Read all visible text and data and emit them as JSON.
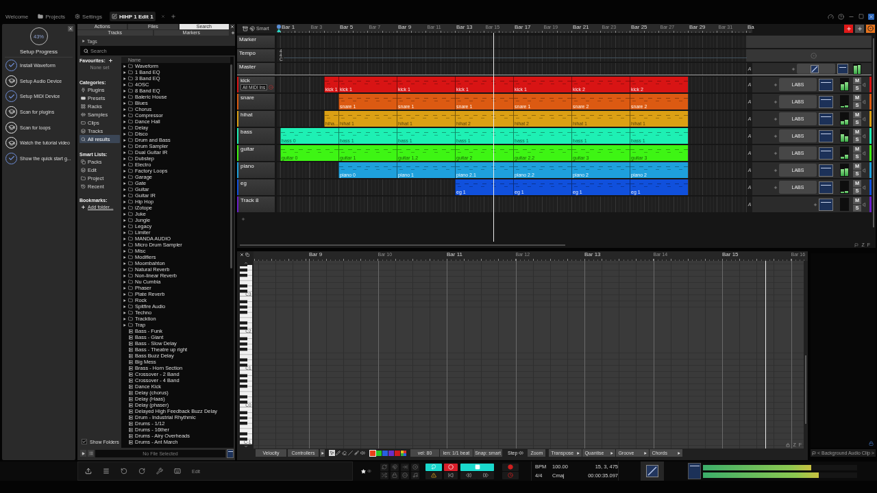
{
  "top_tabs": [
    {
      "label": "Welcome",
      "kind": "text",
      "selected": false
    },
    {
      "label": "Projects",
      "kind": "folder",
      "selected": false
    },
    {
      "label": "Settings",
      "kind": "gear",
      "selected": false
    },
    {
      "label": "HIHP 1 Edit 1",
      "kind": "edit",
      "selected": true
    }
  ],
  "setup": {
    "progress": "43%",
    "title": "Setup Progress",
    "items": [
      {
        "label": "Install Waveform",
        "kind": "done"
      },
      {
        "label": "Setup Audio Device",
        "kind": "todo"
      },
      {
        "label": "Setup MIDI Device",
        "kind": "done"
      },
      {
        "label": "Scan for plugins",
        "kind": "todo"
      },
      {
        "label": "Scan for loops",
        "kind": "todo"
      },
      {
        "label": "Watch the tutorial video",
        "kind": "todo"
      },
      {
        "label": "Show the quick start g...",
        "kind": "done"
      }
    ]
  },
  "browser": {
    "tabs": [
      [
        {
          "label": "Actions",
          "selected": false
        },
        {
          "label": "Files",
          "selected": false
        },
        {
          "label": "Search",
          "selected": true
        }
      ],
      [
        {
          "label": "Tracks",
          "selected": false
        },
        {
          "label": "Markers",
          "selected": false
        }
      ]
    ],
    "tags": "Tags",
    "search": {
      "placeholder": "Search"
    },
    "favourites": {
      "heading": "Favourites:",
      "empty": "None set"
    },
    "categories": {
      "heading": "Categories:",
      "items": [
        {
          "label": "Plugins",
          "kind": "plug",
          "selected": false
        },
        {
          "label": "Presets",
          "kind": "preset",
          "selected": false
        },
        {
          "label": "Racks",
          "kind": "rack",
          "selected": false
        },
        {
          "label": "Samples",
          "kind": "sample",
          "selected": false
        },
        {
          "label": "Clips",
          "kind": "clip",
          "selected": false
        },
        {
          "label": "Tracks",
          "kind": "track",
          "selected": false
        },
        {
          "label": "All results",
          "kind": "search",
          "selected": true
        }
      ]
    },
    "smart_lists": {
      "heading": "Smart Lists:",
      "items": [
        {
          "label": "Packs",
          "kind": "pack",
          "selected": false
        },
        {
          "label": "Edit",
          "kind": "edit",
          "selected": false
        },
        {
          "label": "Project",
          "kind": "folder",
          "selected": false
        },
        {
          "label": "Recent",
          "kind": "recent",
          "selected": false
        }
      ]
    },
    "bookmarks": {
      "heading": "Bookmarks:",
      "link": "Add folder..."
    },
    "show_folders": {
      "label": "Show Folders",
      "checked": true
    },
    "column": "Name",
    "files": [
      {
        "name": "Waveform",
        "kind": "folder"
      },
      {
        "name": "1 Band EQ",
        "kind": "folder"
      },
      {
        "name": "3 Band EQ",
        "kind": "folder"
      },
      {
        "name": "4OSC",
        "kind": "folder"
      },
      {
        "name": "8 Band EQ",
        "kind": "folder"
      },
      {
        "name": "Baleric House",
        "kind": "folder"
      },
      {
        "name": "Blues",
        "kind": "folder"
      },
      {
        "name": "Chorus",
        "kind": "folder"
      },
      {
        "name": "Compressor",
        "kind": "folder"
      },
      {
        "name": "Dance Hall",
        "kind": "folder"
      },
      {
        "name": "Delay",
        "kind": "folder"
      },
      {
        "name": "Disco",
        "kind": "folder"
      },
      {
        "name": "Drum and Bass",
        "kind": "folder"
      },
      {
        "name": "Drum Sampler",
        "kind": "folder"
      },
      {
        "name": "Dual Guitar IR",
        "kind": "folder"
      },
      {
        "name": "Dubstep",
        "kind": "folder"
      },
      {
        "name": "Electro",
        "kind": "folder"
      },
      {
        "name": "Factory Loops",
        "kind": "folder"
      },
      {
        "name": "Garage",
        "kind": "folder"
      },
      {
        "name": "Gate",
        "kind": "folder"
      },
      {
        "name": "Guitar",
        "kind": "folder"
      },
      {
        "name": "Guitar IR",
        "kind": "folder"
      },
      {
        "name": "Hip Hop",
        "kind": "folder"
      },
      {
        "name": "iZotope",
        "kind": "folder"
      },
      {
        "name": "Juke",
        "kind": "folder"
      },
      {
        "name": "Jungle",
        "kind": "folder"
      },
      {
        "name": "Legacy",
        "kind": "folder"
      },
      {
        "name": "Limiter",
        "kind": "folder"
      },
      {
        "name": "MANDA AUDIO",
        "kind": "folder"
      },
      {
        "name": "Micro Drum Sampler",
        "kind": "folder"
      },
      {
        "name": "Misc",
        "kind": "folder"
      },
      {
        "name": "Modifiers",
        "kind": "folder"
      },
      {
        "name": "Moombahton",
        "kind": "folder"
      },
      {
        "name": "Natural Reverb",
        "kind": "folder"
      },
      {
        "name": "Non-linear Reverb",
        "kind": "folder"
      },
      {
        "name": "Nu Cumbia",
        "kind": "folder"
      },
      {
        "name": "Phaser",
        "kind": "folder"
      },
      {
        "name": "Plate Reverb",
        "kind": "folder"
      },
      {
        "name": "Rock",
        "kind": "folder"
      },
      {
        "name": "Spitfire Audio",
        "kind": "folder"
      },
      {
        "name": "Techno",
        "kind": "folder"
      },
      {
        "name": "Tracktion",
        "kind": "folder"
      },
      {
        "name": "Trap",
        "kind": "folder"
      },
      {
        "name": "Bass - Funk",
        "kind": "preset"
      },
      {
        "name": "Bass - Giant",
        "kind": "preset"
      },
      {
        "name": "Bass - Slow Delay",
        "kind": "preset"
      },
      {
        "name": "Bass - Theatre up right",
        "kind": "preset"
      },
      {
        "name": "Bass Buzz Delay",
        "kind": "preset"
      },
      {
        "name": "Big Mess",
        "kind": "preset"
      },
      {
        "name": "Brass - Horn Section",
        "kind": "preset"
      },
      {
        "name": "Crossover - 2 Band",
        "kind": "preset"
      },
      {
        "name": "Crossover - 4 Band",
        "kind": "preset"
      },
      {
        "name": "Dance Kick",
        "kind": "preset"
      },
      {
        "name": "Delay (chorus)",
        "kind": "preset"
      },
      {
        "name": "Delay (Haas)",
        "kind": "preset"
      },
      {
        "name": "Delay (phaser)",
        "kind": "preset"
      },
      {
        "name": "Delayed High Feedback Buzz Delay",
        "kind": "preset"
      },
      {
        "name": "Drum - Industrial Rhythmic",
        "kind": "preset"
      },
      {
        "name": "Drums - 1/12",
        "kind": "preset"
      },
      {
        "name": "Drums - 16ther",
        "kind": "preset"
      },
      {
        "name": "Drums - Airy Overheads",
        "kind": "preset"
      },
      {
        "name": "Drums - Ant March",
        "kind": "preset"
      }
    ],
    "status": "No File Selected"
  },
  "arranger": {
    "mode": "Smart",
    "ruler": [
      {
        "label": "Bar 1",
        "major": true
      },
      {
        "label": "Bar 3",
        "major": false
      },
      {
        "label": "Bar 5",
        "major": true
      },
      {
        "label": "Bar 7",
        "major": false
      },
      {
        "label": "Bar 9",
        "major": true
      },
      {
        "label": "Bar 11",
        "major": false
      },
      {
        "label": "Bar 13",
        "major": true
      },
      {
        "label": "Bar 15",
        "major": false
      },
      {
        "label": "Bar 17",
        "major": true
      },
      {
        "label": "Bar 19",
        "major": false
      },
      {
        "label": "Bar 21",
        "major": true
      },
      {
        "label": "Bar 23",
        "major": false
      },
      {
        "label": "Bar 25",
        "major": true
      },
      {
        "label": "Bar 27",
        "major": false
      },
      {
        "label": "Bar 29",
        "major": true
      },
      {
        "label": "Bar 31",
        "major": false
      },
      {
        "label": "Ba",
        "major": true
      }
    ],
    "tracks": [
      {
        "name": "Marker",
        "kind": "marker"
      },
      {
        "name": "Tempo",
        "kind": "tempo",
        "signature": [
          "4",
          "4",
          "C"
        ]
      },
      {
        "name": "Master",
        "kind": "master",
        "automation": "A",
        "meter": [
          {
            "level": 0.8
          },
          {
            "level": 0.9
          }
        ]
      },
      {
        "name": "kick",
        "kind": "instrument",
        "color": "#d81414",
        "input": "All MIDI Ins",
        "automation": "A",
        "plugin": "LABS",
        "mute": "M",
        "solo": "S",
        "meter": [
          {
            "level": 0.55
          },
          {
            "level": 0.7
          }
        ],
        "clips": [
          {
            "label": "kick 1",
            "kind": "short"
          },
          {
            "label": "kick 1",
            "kind": "long"
          },
          {
            "label": "kick 1",
            "kind": "long"
          },
          {
            "label": "kick 1",
            "kind": "long"
          },
          {
            "label": "kick 1",
            "kind": "long"
          },
          {
            "label": "kick 2",
            "kind": "long"
          },
          {
            "label": "kick 2",
            "kind": "long"
          }
        ]
      },
      {
        "name": "snare",
        "kind": "instrument",
        "color": "#dc5a12",
        "automation": "A",
        "plugin": "LABS",
        "mute": "M",
        "solo": "S",
        "meter": [
          {
            "level": 0.12
          },
          {
            "level": 0.18
          }
        ],
        "clips": [
          {
            "label": "snare 1",
            "kind": "long"
          },
          {
            "label": "snare 1",
            "kind": "long"
          },
          {
            "label": "snare 1",
            "kind": "long"
          },
          {
            "label": "snare 1",
            "kind": "long"
          },
          {
            "label": "snare 2",
            "kind": "long"
          },
          {
            "label": "snare 2",
            "kind": "long"
          }
        ]
      },
      {
        "name": "hihat",
        "kind": "instrument",
        "color": "#dca014",
        "automation": "A",
        "plugin": "LABS",
        "mute": "M",
        "solo": "S",
        "meter": [
          {
            "level": 0.3
          },
          {
            "level": 0.4
          }
        ],
        "clips": [
          {
            "label": "hiha...",
            "kind": "short"
          },
          {
            "label": "hihat 1",
            "kind": "long"
          },
          {
            "label": "hihat 1",
            "kind": "long"
          },
          {
            "label": "hihat 2",
            "kind": "long"
          },
          {
            "label": "hihat 2",
            "kind": "long"
          },
          {
            "label": "hihat 1",
            "kind": "long"
          },
          {
            "label": "hihat 1",
            "kind": "long"
          }
        ]
      },
      {
        "name": "bass",
        "kind": "instrument",
        "color": "#1ef0b4",
        "automation": "A",
        "plugin": "LABS",
        "mute": "M",
        "solo": "S",
        "meter": [
          {
            "level": 0.65
          },
          {
            "level": 0.5
          }
        ],
        "clips": [
          {
            "label": "bass 0",
            "kind": "long"
          },
          {
            "label": "bass 1",
            "kind": "long"
          },
          {
            "label": "bass 1",
            "kind": "long"
          },
          {
            "label": "bass 1",
            "kind": "long"
          },
          {
            "label": "bass 1",
            "kind": "long"
          },
          {
            "label": "bass 1",
            "kind": "long"
          },
          {
            "label": "bass 1",
            "kind": "long"
          }
        ]
      },
      {
        "name": "guitar",
        "kind": "instrument",
        "color": "#3ef514",
        "automation": "A",
        "plugin": "LABS",
        "mute": "M",
        "solo": "S",
        "meter": [
          {
            "level": 0.15
          },
          {
            "level": 0.35
          }
        ],
        "clips": [
          {
            "label": "guitar 0",
            "kind": "long"
          },
          {
            "label": "guitar 1",
            "kind": "long"
          },
          {
            "label": "guitar 1.2",
            "kind": "long"
          },
          {
            "label": "guitar 2",
            "kind": "long"
          },
          {
            "label": "guitar 2.2",
            "kind": "long"
          },
          {
            "label": "guitar 3",
            "kind": "long"
          },
          {
            "label": "guitar 3",
            "kind": "long"
          }
        ]
      },
      {
        "name": "piano",
        "kind": "instrument",
        "color": "#1ea0dc",
        "automation": "A",
        "plugin": "LABS",
        "mute": "M",
        "solo": "S",
        "meter": [
          {
            "level": 0.6
          },
          {
            "level": 0.65
          }
        ],
        "clips": [
          {
            "label": "piano 0",
            "kind": "long"
          },
          {
            "label": "piano 1",
            "kind": "long"
          },
          {
            "label": "piano 2.1",
            "kind": "long"
          },
          {
            "label": "piano 2.2",
            "kind": "long"
          },
          {
            "label": "piano 2",
            "kind": "long"
          },
          {
            "label": "piano 2",
            "kind": "long"
          }
        ]
      },
      {
        "name": "eg",
        "kind": "instrument",
        "color": "#1050dc",
        "automation": "A",
        "plugin": "LABS",
        "mute": "M",
        "solo": "S",
        "meter": [
          {
            "level": 0.1
          },
          {
            "level": 0.15
          }
        ],
        "clips": [
          {
            "label": "eg 1",
            "kind": "long"
          },
          {
            "label": "eg 1",
            "kind": "long"
          },
          {
            "label": "eg 1",
            "kind": "long"
          },
          {
            "label": "eg 1",
            "kind": "long"
          }
        ]
      },
      {
        "name": "Track 8",
        "kind": "instrument",
        "color": "#6a1fc8",
        "automation": "A",
        "mute": "M",
        "solo": "S"
      }
    ],
    "footer": [
      "Z",
      "F"
    ]
  },
  "piano_roll": {
    "ruler": [
      {
        "label": "Bar 9",
        "major": true
      },
      {
        "label": "Bar 10",
        "major": false
      },
      {
        "label": "Bar 11",
        "major": true
      },
      {
        "label": "Bar 12",
        "major": false
      },
      {
        "label": "Bar 13",
        "major": true
      },
      {
        "label": "Bar 14",
        "major": false
      },
      {
        "label": "Bar 15",
        "major": true
      },
      {
        "label": "Bar 16",
        "major": false
      }
    ],
    "keys": [
      "C3",
      "C2",
      "C1",
      "C0",
      "C-1"
    ],
    "footer": [
      "Z",
      "F"
    ],
    "toolbar": {
      "views": [
        "Velocity",
        "Controllers"
      ],
      "tools": [
        {
          "kind": "pointer",
          "selected": true
        },
        {
          "kind": "pencil",
          "selected": false
        },
        {
          "kind": "eraser",
          "selected": false
        },
        {
          "kind": "line",
          "selected": false
        },
        {
          "kind": "brush",
          "selected": false
        },
        {
          "kind": "speaker",
          "selected": false
        }
      ],
      "swatches": [
        {
          "color": "#e8401a",
          "selected": true
        },
        {
          "color": "#28c828",
          "selected": false
        },
        {
          "color": "#2860e0",
          "selected": false
        },
        {
          "color": "#6a30c8",
          "selected": false
        },
        {
          "color": "#d01c1c",
          "selected": false
        }
      ],
      "fields": [
        "vel: 80",
        "len: 1/1 beat",
        "Snap: smart"
      ],
      "step": "Step",
      "zoom": "Zoom",
      "menus": [
        "Transpose",
        "Quantise",
        "Groove",
        "Chords"
      ]
    },
    "side_label": "< Background Audio Clip >"
  },
  "transport": {
    "top": [
      {
        "kind": "loop",
        "on": false
      },
      {
        "kind": "magnet",
        "on": false
      },
      {
        "kind": "punch",
        "on": false
      },
      {
        "kind": "metronome",
        "on": false
      },
      {
        "kind": "play_loop",
        "on": true
      },
      {
        "kind": "record",
        "on": true
      },
      {
        "kind": "play",
        "on": true
      },
      {
        "kind": "record_dot",
        "on": false
      }
    ],
    "bottom": [
      {
        "kind": "shuffle",
        "on": false
      },
      {
        "kind": "lock",
        "on": false
      },
      {
        "kind": "minus",
        "on": false
      },
      {
        "kind": "midi",
        "on": false
      },
      {
        "kind": "warning",
        "on": false
      },
      {
        "kind": "skip_back",
        "on": false
      },
      {
        "kind": "rewind",
        "on": false
      },
      {
        "kind": "forward",
        "on": false
      },
      {
        "kind": "clock",
        "on": false
      }
    ],
    "bpm_label": "BPM",
    "bpm": "100.00",
    "signature": "4/4",
    "key": "Cmaj",
    "position": "15, 3, 475",
    "time": "00:00:35.097"
  },
  "bottom": {
    "mode": "Edit",
    "meters": [
      {
        "level": 0.7
      },
      {
        "level": 0.75
      }
    ]
  }
}
